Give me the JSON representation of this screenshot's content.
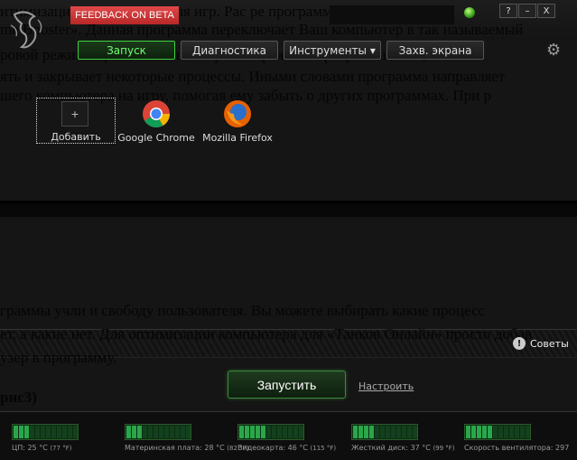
{
  "background_text": [
    "итимизацию компьютера для игр. Рас                              ре программы",
    "me Booster». Данная программа переключает Ваш компьютер в так называемый",
    "ровой режим. При включении игрового режима программа очищает оп",
    "ять и закрывает некоторые процессы. Иными словами программа направляет",
    "шего компьютера на игру, помогая ему забыть о других программах. При р",
    "граммы учли и свободу пользователя. Вы можете выбирать какие процесс",
    "ет, а какие нет. Для оптимизации компьютера для «Танков Онлайн» просто добав",
    "узер в программу.",
    "рис3)"
  ],
  "header": {
    "feedback_label": "FEEDBACK ON BETA",
    "window_buttons": {
      "help": "?",
      "minimize": "–",
      "close": "X"
    }
  },
  "tabs": [
    {
      "label": "Запуск",
      "active": true
    },
    {
      "label": "Диагностика",
      "active": false
    },
    {
      "label": "Инструменты ▾",
      "active": false
    },
    {
      "label": "Захв. экрана",
      "active": false
    }
  ],
  "apps": {
    "add": {
      "icon": "+",
      "label": "Добавить"
    },
    "items": [
      {
        "label": "Google Chrome"
      },
      {
        "label": "Mozilla Firefox"
      }
    ]
  },
  "tips": {
    "icon": "!",
    "label": "Советы"
  },
  "launch_label": "Запустить",
  "configure_label": "Настроить",
  "sensors": [
    {
      "label": "ЦП: 25 °C",
      "sub": "(77 °F)",
      "level": 3,
      "max": 12
    },
    {
      "label": "Материнская плата: 28 °C",
      "sub": "(82 °F)",
      "level": 3,
      "max": 12
    },
    {
      "label": "Видеокарта: 46 °C",
      "sub": "(115 °F)",
      "level": 5,
      "max": 12
    },
    {
      "label": "Жесткий диск: 37 °C",
      "sub": "(99 °F)",
      "level": 4,
      "max": 12
    },
    {
      "label": "Скорость вентилятора: 297",
      "sub": "",
      "level": 5,
      "max": 12
    }
  ],
  "colors": {
    "accent": "#3fcf3f",
    "feedback": "#d03838"
  }
}
